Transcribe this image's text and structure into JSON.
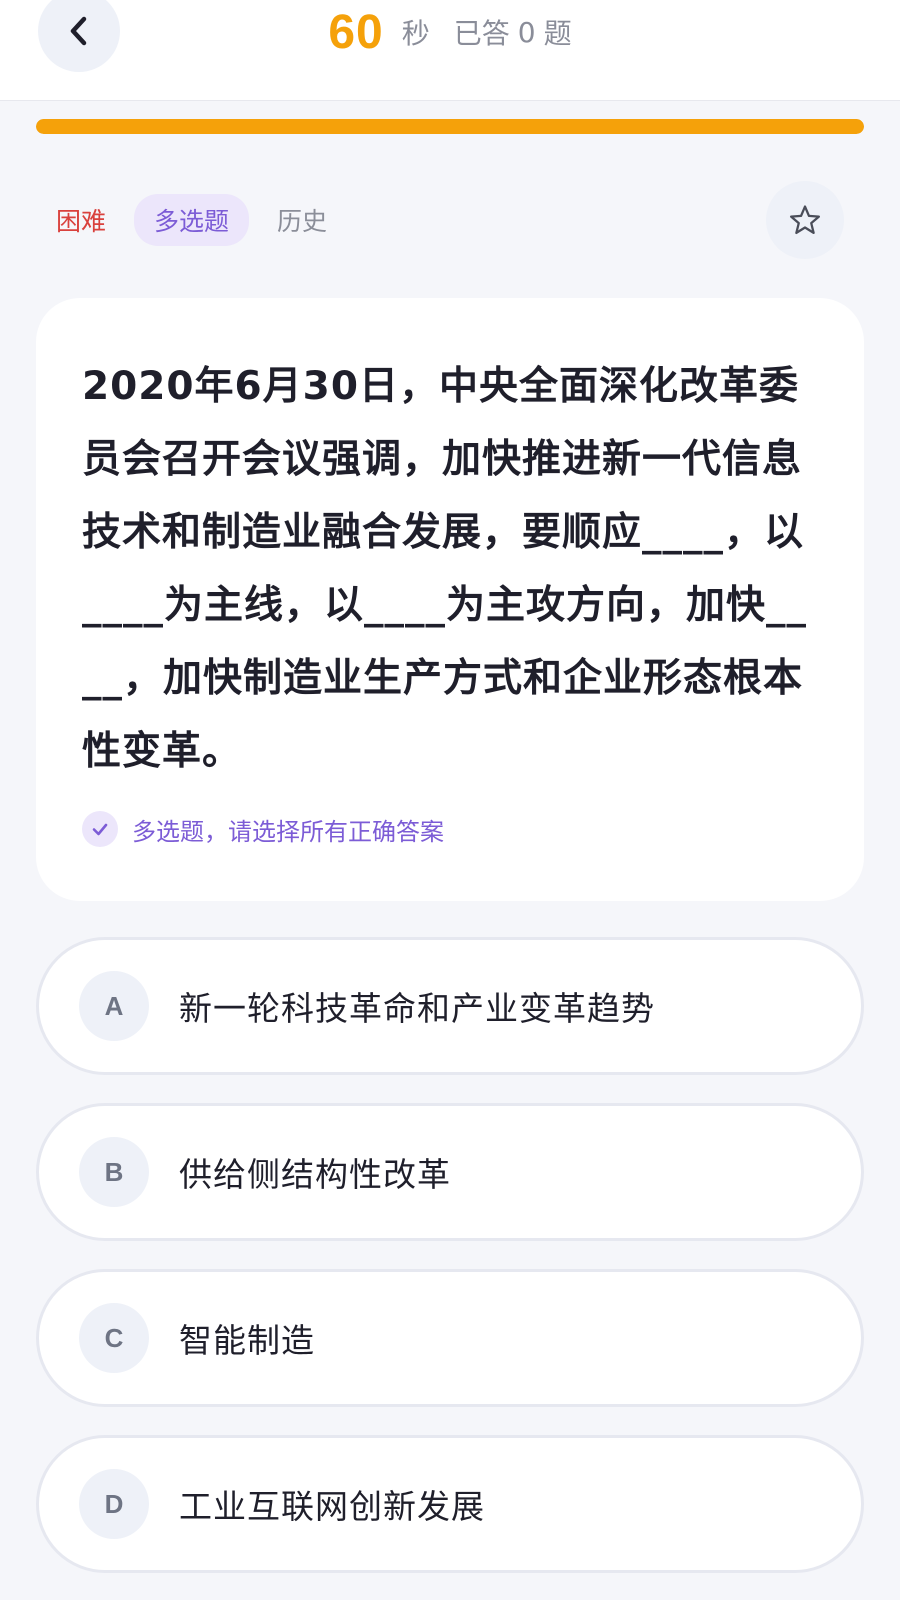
{
  "header": {
    "back_icon": "chevron-left-icon",
    "timer_value": "60",
    "timer_unit": "秒",
    "answered_label": "已答",
    "answered_count": "0",
    "answered_suffix": "题"
  },
  "progress": {
    "fraction": 1.0,
    "color": "#f5a10a"
  },
  "tags": {
    "difficulty": "困难",
    "type": "多选题",
    "category": "历史",
    "favorite_icon": "star-outline-icon"
  },
  "question": {
    "text": "2020年6月30日，中央全面深化改革委员会召开会议强调，加快推进新一代信息技术和制造业融合发展，要顺应____，以____为主线，以____为主攻方向，加快____，加快制造业生产方式和企业形态根本性变革。",
    "hint_icon": "check-icon",
    "hint": "多选题，请选择所有正确答案"
  },
  "options": [
    {
      "letter": "A",
      "text": "新一轮科技革命和产业变革趋势"
    },
    {
      "letter": "B",
      "text": "供给侧结构性改革"
    },
    {
      "letter": "C",
      "text": "智能制造"
    },
    {
      "letter": "D",
      "text": "工业互联网创新发展"
    }
  ],
  "colors": {
    "accent": "#f5a10a",
    "difficulty": "#d9413d",
    "type_tag": "#7c5cd6",
    "background": "#f5f6fa"
  }
}
